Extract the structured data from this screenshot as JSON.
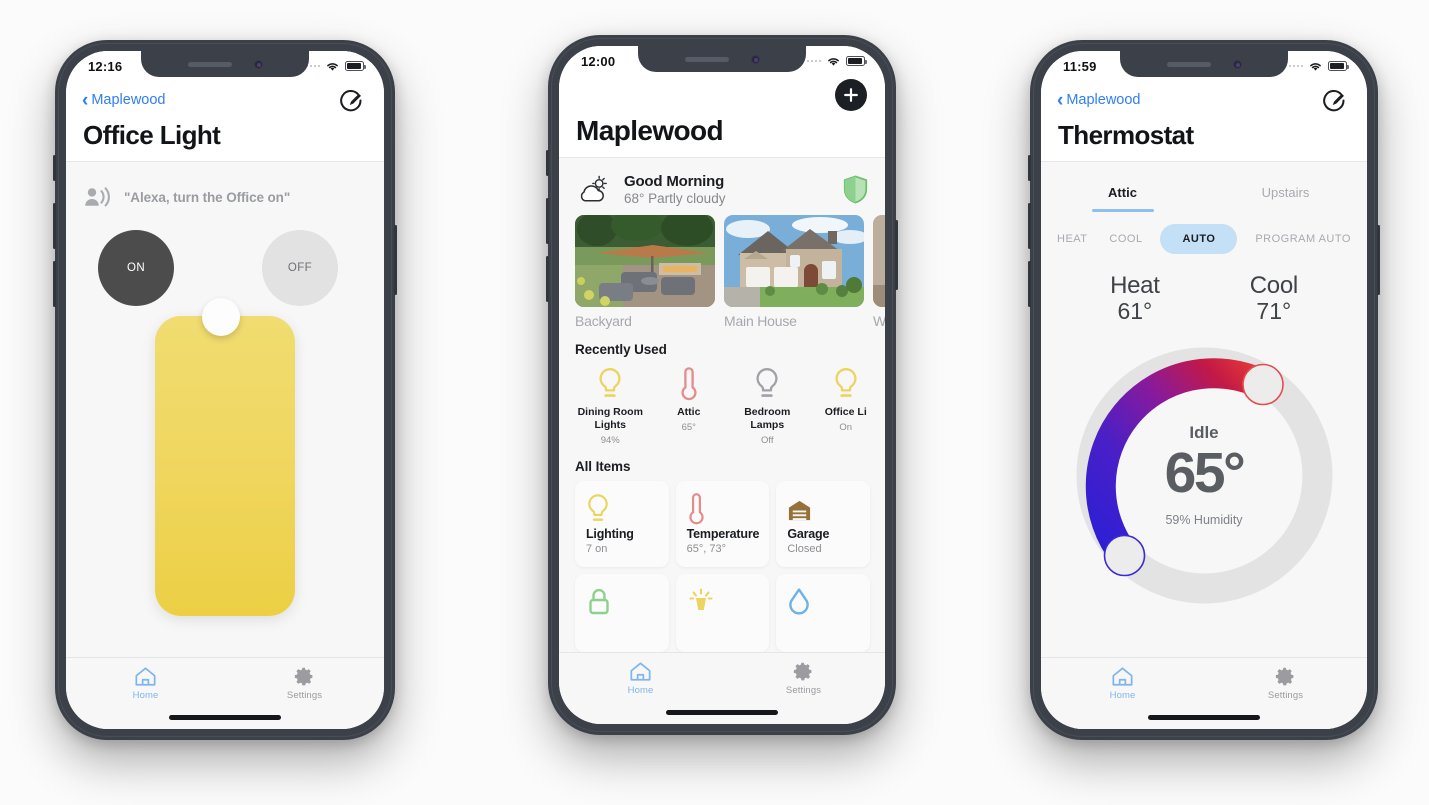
{
  "phones": {
    "light": {
      "status": {
        "time": "12:16"
      },
      "nav": {
        "back_label": "Maplewood",
        "edit_icon": "edit-pencil-circle-icon"
      },
      "title": "Office Light",
      "voice": {
        "icon": "voice-assistant-icon",
        "phrase": "\"Alexa, turn the Office on\""
      },
      "buttons": {
        "on": "ON",
        "off": "OFF"
      },
      "slider": {
        "name": "brightness-slider",
        "color": "#eed257",
        "value_pct": 94
      },
      "tabs": [
        {
          "label": "Home",
          "icon": "home-icon",
          "active": true
        },
        {
          "label": "Settings",
          "icon": "gear-icon",
          "active": false
        }
      ]
    },
    "home": {
      "status": {
        "time": "12:00"
      },
      "nav": {
        "add_icon": "plus-circle-icon"
      },
      "title": "Maplewood",
      "weather": {
        "icon": "sun-behind-cloud-icon",
        "greeting": "Good Morning",
        "conditions": "68° Partly cloudy",
        "shield_icon": "shield-icon",
        "shield_color": "#8ed18e"
      },
      "rooms": [
        {
          "name": "Backyard",
          "photo": "backyard-patio-photo"
        },
        {
          "name": "Main House",
          "photo": "main-house-exterior-photo"
        },
        {
          "name": "W",
          "photo": "third-room-photo"
        }
      ],
      "recently_used_title": "Recently Used",
      "recently_used": [
        {
          "name": "Dining Room Lights",
          "value": "94%",
          "icon": "bulb-icon",
          "color": "#ecd45f"
        },
        {
          "name": "Attic",
          "value": "65°",
          "icon": "thermometer-icon",
          "color": "#e58b8b"
        },
        {
          "name": "Bedroom Lamps",
          "value": "Off",
          "icon": "bulb-icon",
          "color": "#a0a2a6"
        },
        {
          "name": "Office Li",
          "value": "On",
          "icon": "bulb-icon",
          "color": "#ecd45f"
        }
      ],
      "all_items_title": "All Items",
      "all_items": [
        {
          "name": "Lighting",
          "sub": "7 on",
          "icon": "bulb-icon",
          "color": "#ecd45f"
        },
        {
          "name": "Temperature",
          "sub": "65°, 73°",
          "icon": "thermometer-icon",
          "color": "#e58b8b"
        },
        {
          "name": "Garage",
          "sub": "Closed",
          "icon": "garage-icon",
          "color": "#97713a"
        },
        {
          "name": "",
          "sub": "",
          "icon": "lock-icon",
          "color": "#8ed18e"
        },
        {
          "name": "",
          "sub": "",
          "icon": "sconce-light-icon",
          "color": "#ecd45f"
        },
        {
          "name": "",
          "sub": "",
          "icon": "water-drop-icon",
          "color": "#6cb3e8"
        }
      ],
      "tabs": [
        {
          "label": "Home",
          "icon": "home-icon",
          "active": true
        },
        {
          "label": "Settings",
          "icon": "gear-icon",
          "active": false
        }
      ]
    },
    "thermostat": {
      "status": {
        "time": "11:59"
      },
      "nav": {
        "back_label": "Maplewood",
        "edit_icon": "edit-pencil-circle-icon"
      },
      "title": "Thermostat",
      "zones": [
        {
          "label": "Attic",
          "active": true
        },
        {
          "label": "Upstairs",
          "active": false
        }
      ],
      "modes": [
        {
          "label": "HEAT",
          "selected": false
        },
        {
          "label": "COOL",
          "selected": false
        },
        {
          "label": "AUTO",
          "selected": true
        },
        {
          "label": "PROGRAM AUTO",
          "selected": false
        }
      ],
      "setpoints": [
        {
          "label": "Heat",
          "value": "61°"
        },
        {
          "label": "Cool",
          "value": "71°"
        }
      ],
      "dial": {
        "state": "Idle",
        "temperature": "65°",
        "humidity": "59% Humidity",
        "heat_handle_color": "#3d2ad6",
        "cool_handle_color": "#e44c4c",
        "track_color": "#e2e2e3"
      },
      "tabs": [
        {
          "label": "Home",
          "icon": "home-icon",
          "active": true
        },
        {
          "label": "Settings",
          "icon": "gear-icon",
          "active": false
        }
      ]
    }
  }
}
